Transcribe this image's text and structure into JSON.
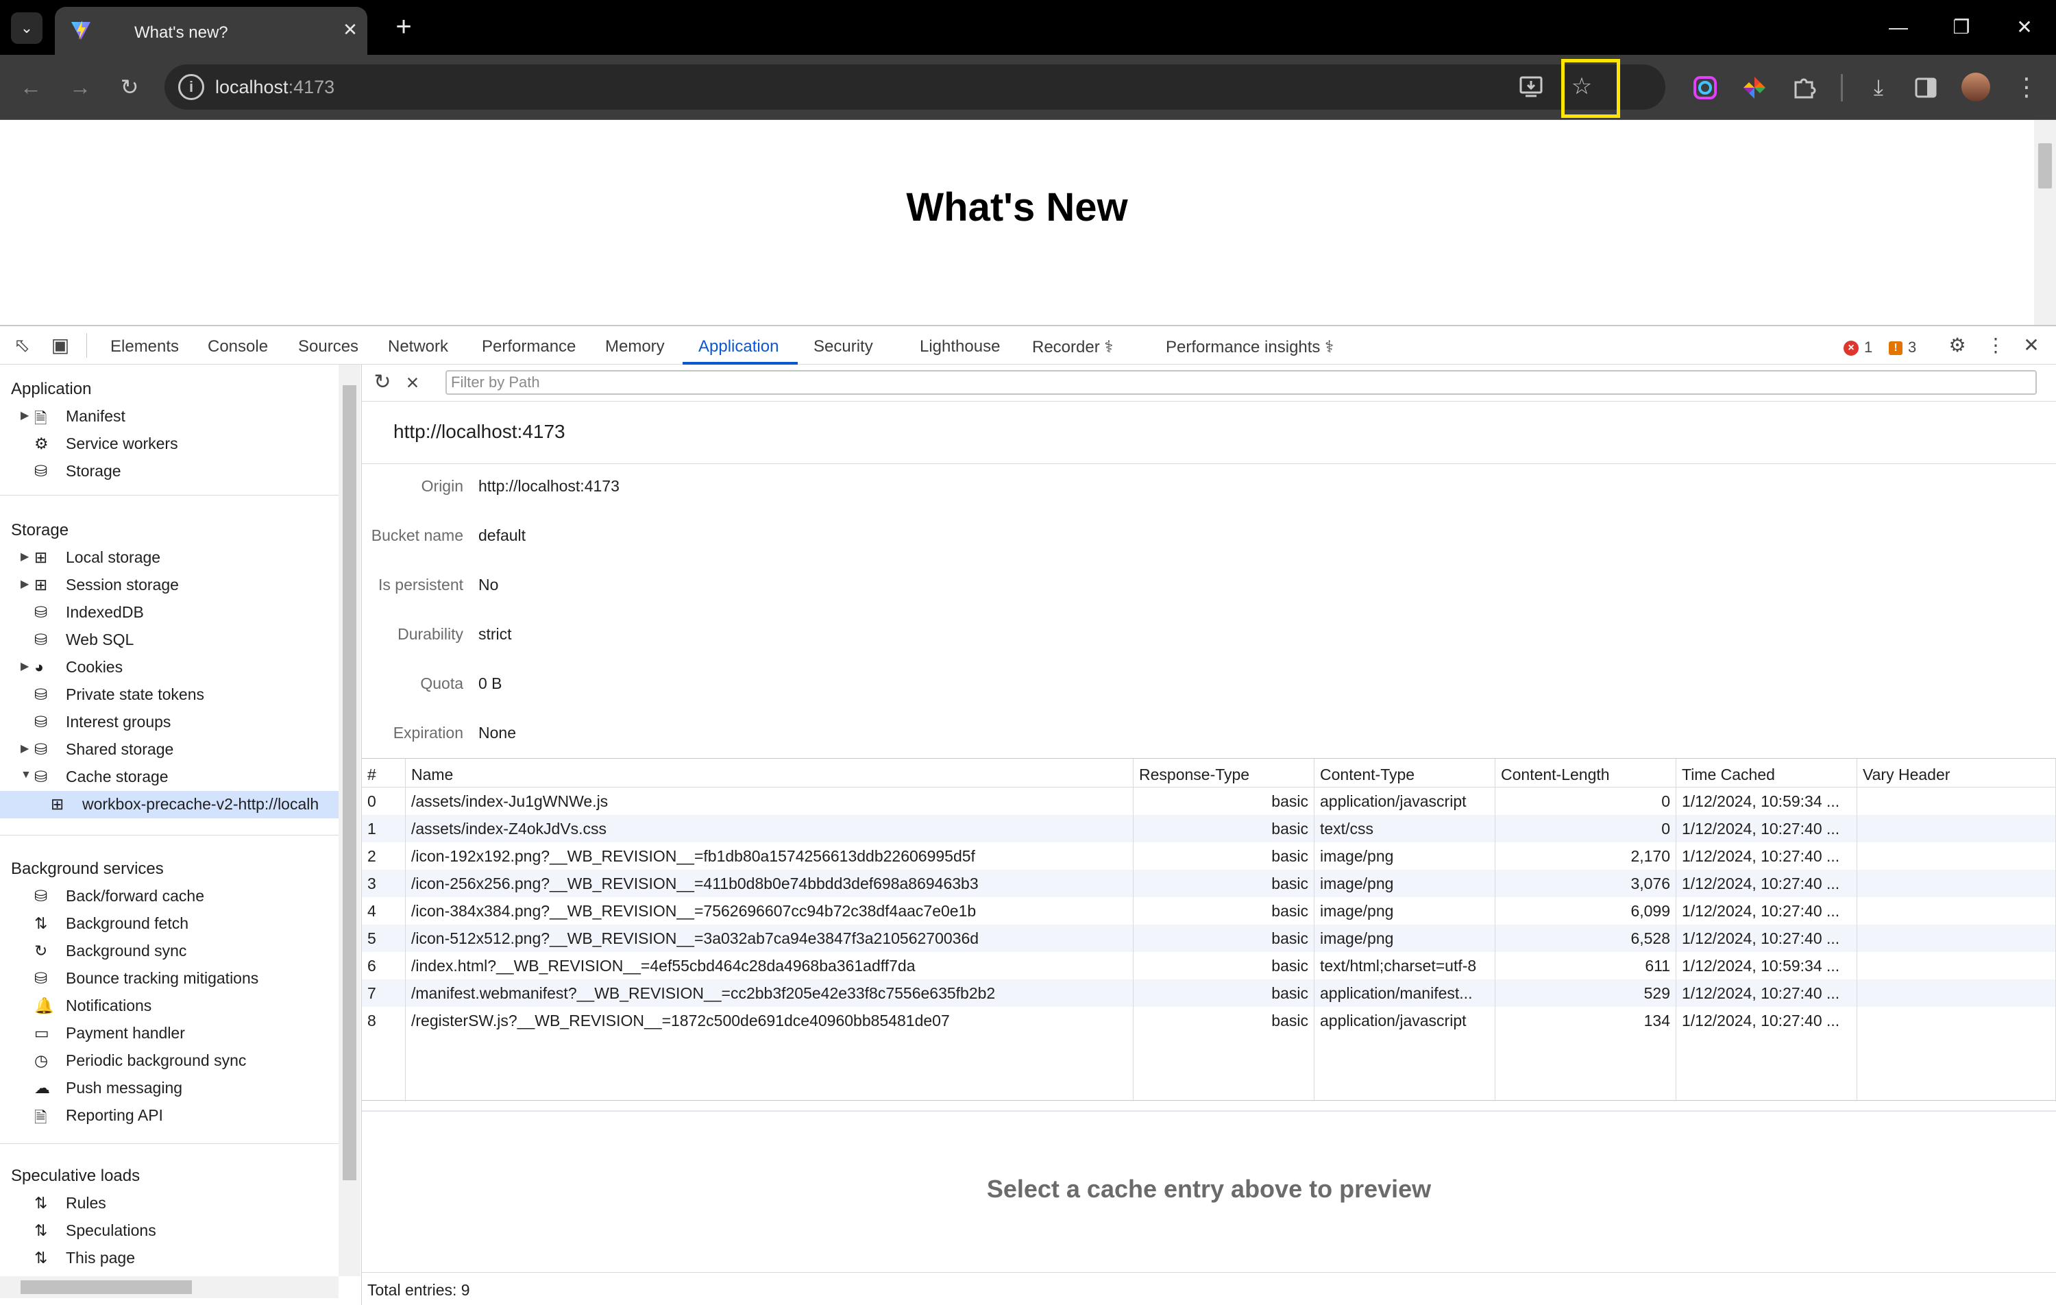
{
  "browser": {
    "tab_title": "What's new?",
    "url_host": "localhost",
    "url_port": ":4173"
  },
  "page": {
    "heading": "What's New"
  },
  "devtools": {
    "tabs": [
      "Elements",
      "Console",
      "Sources",
      "Network",
      "Performance",
      "Memory",
      "Application",
      "Security",
      "Lighthouse",
      "Recorder",
      "Performance insights"
    ],
    "active_tab": "Application",
    "error_count": "1",
    "warning_count": "3",
    "colors": {
      "accent": "#0b57d0",
      "selected_bg": "#d3e3fd",
      "error": "#dc362e",
      "warning": "#e37400",
      "highlight": "#ffe600"
    }
  },
  "sidebar": {
    "application": {
      "title": "Application",
      "items": [
        "Manifest",
        "Service workers",
        "Storage"
      ]
    },
    "storage": {
      "title": "Storage",
      "items": [
        "Local storage",
        "Session storage",
        "IndexedDB",
        "Web SQL",
        "Cookies",
        "Private state tokens",
        "Interest groups",
        "Shared storage",
        "Cache storage",
        "workbox-precache-v2-http://localh"
      ]
    },
    "background": {
      "title": "Background services",
      "items": [
        "Back/forward cache",
        "Background fetch",
        "Background sync",
        "Bounce tracking mitigations",
        "Notifications",
        "Payment handler",
        "Periodic background sync",
        "Push messaging",
        "Reporting API"
      ]
    },
    "speculative": {
      "title": "Speculative loads",
      "items": [
        "Rules",
        "Speculations",
        "This page"
      ]
    }
  },
  "main": {
    "filter_placeholder": "Filter by Path",
    "cache_title": "http://localhost:4173",
    "meta": {
      "origin_label": "Origin",
      "origin": "http://localhost:4173",
      "bucket_label": "Bucket name",
      "bucket": "default",
      "persistent_label": "Is persistent",
      "persistent": "No",
      "durability_label": "Durability",
      "durability": "strict",
      "quota_label": "Quota",
      "quota": "0 B",
      "expiration_label": "Expiration",
      "expiration": "None"
    },
    "columns": [
      "#",
      "Name",
      "Response-Type",
      "Content-Type",
      "Content-Length",
      "Time Cached",
      "Vary Header"
    ],
    "rows": [
      [
        "0",
        "/assets/index-Ju1gWNWe.js",
        "basic",
        "application/javascript",
        "0",
        "1/12/2024, 10:59:34 ...",
        ""
      ],
      [
        "1",
        "/assets/index-Z4okJdVs.css",
        "basic",
        "text/css",
        "0",
        "1/12/2024, 10:27:40 ...",
        ""
      ],
      [
        "2",
        "/icon-192x192.png?__WB_REVISION__=fb1db80a1574256613ddb22606995d5f",
        "basic",
        "image/png",
        "2,170",
        "1/12/2024, 10:27:40 ...",
        ""
      ],
      [
        "3",
        "/icon-256x256.png?__WB_REVISION__=411b0d8b0e74bbdd3def698a869463b3",
        "basic",
        "image/png",
        "3,076",
        "1/12/2024, 10:27:40 ...",
        ""
      ],
      [
        "4",
        "/icon-384x384.png?__WB_REVISION__=7562696607cc94b72c38df4aac7e0e1b",
        "basic",
        "image/png",
        "6,099",
        "1/12/2024, 10:27:40 ...",
        ""
      ],
      [
        "5",
        "/icon-512x512.png?__WB_REVISION__=3a032ab7ca94e3847f3a21056270036d",
        "basic",
        "image/png",
        "6,528",
        "1/12/2024, 10:27:40 ...",
        ""
      ],
      [
        "6",
        "/index.html?__WB_REVISION__=4ef55cbd464c28da4968ba361adff7da",
        "basic",
        "text/html;charset=utf-8",
        "611",
        "1/12/2024, 10:59:34 ...",
        ""
      ],
      [
        "7",
        "/manifest.webmanifest?__WB_REVISION__=cc2bb3f205e42e33f8c7556e635fb2b2",
        "basic",
        "application/manifest...",
        "529",
        "1/12/2024, 10:27:40 ...",
        ""
      ],
      [
        "8",
        "/registerSW.js?__WB_REVISION__=1872c500de691dce40960bb85481de07",
        "basic",
        "application/javascript",
        "134",
        "1/12/2024, 10:27:40 ...",
        ""
      ]
    ],
    "preview_text": "Select a cache entry above to preview",
    "total_entries": "Total entries: 9"
  }
}
